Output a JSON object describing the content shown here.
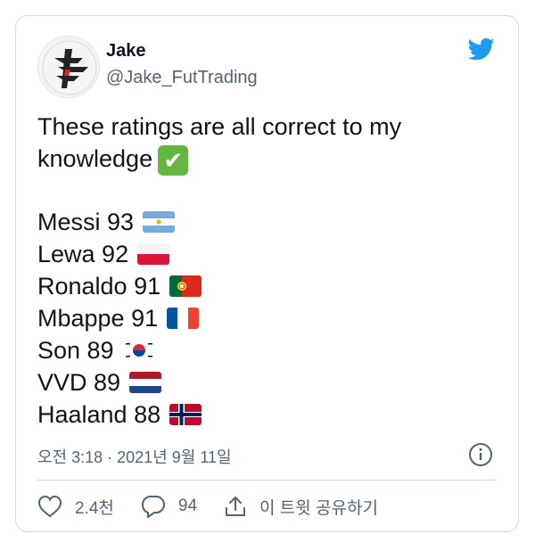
{
  "tweet": {
    "author_name": "Jake",
    "author_handle": "@Jake_FutTrading",
    "text_line1": "These ratings are all correct to my",
    "text_line2": "knowledge",
    "ratings": [
      {
        "label": "Messi 93",
        "flag": "argentina"
      },
      {
        "label": "Lewa 92",
        "flag": "poland"
      },
      {
        "label": "Ronaldo 91",
        "flag": "portugal"
      },
      {
        "label": "Mbappe 91",
        "flag": "france"
      },
      {
        "label": "Son 89",
        "flag": "south-korea"
      },
      {
        "label": "VVD 89",
        "flag": "netherlands"
      },
      {
        "label": "Haaland 88",
        "flag": "norway"
      }
    ],
    "timestamp": "오전 3:18 · 2021년 9월 11일",
    "likes": "2.4천",
    "replies": "94",
    "share_label": "이 트윗 공유하기"
  },
  "colors": {
    "accent": "#1d9bf0",
    "muted": "#536471",
    "border": "#cfd9de"
  }
}
